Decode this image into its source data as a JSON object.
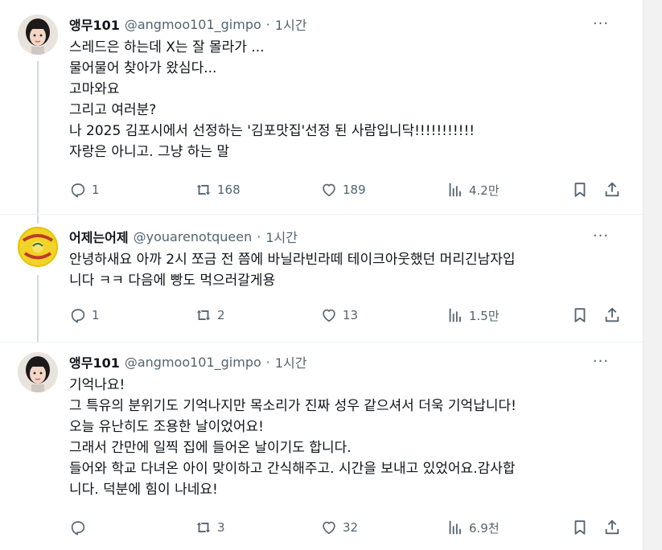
{
  "tweets": [
    {
      "name": "앵무101",
      "handle": "@angmoo101_gimpo",
      "dot": "·",
      "time": "1시간",
      "more": "···",
      "lines": [
        "스레드은 하는데 X는 잘 몰라가 ...",
        "물어물어 찾아가 왔심다...",
        "고마와요",
        "그리고 여러분?",
        "나 2025 김포시에서 선정하는 '김포맛집'선정 된 사람입니닥!!!!!!!!!!!",
        "자랑은 아니고. 그냥 하는 말"
      ],
      "replies": "1",
      "retweets": "168",
      "likes": "189",
      "views": "4.2만"
    },
    {
      "name": "어제는어제",
      "handle": "@youarenotqueen",
      "dot": "·",
      "time": "1시간",
      "more": "···",
      "lines": [
        "안녕하새요 아까 2시 쪼금 전 쯤에 바닐라빈라떼 테이크아웃했던 머리긴남자입",
        "니다 ㅋㅋ 다음에 빵도 먹으러갈게용"
      ],
      "replies": "1",
      "retweets": "2",
      "likes": "13",
      "views": "1.5만"
    },
    {
      "name": "앵무101",
      "handle": "@angmoo101_gimpo",
      "dot": "·",
      "time": "1시간",
      "more": "···",
      "lines": [
        "기억나요!",
        "그 특유의 분위기도 기억나지만 목소리가 진짜 성우 같으셔서 더욱 기억납니다!",
        "오늘 유난히도 조용한 날이었어요!",
        "그래서 간만에 일찍 집에 들어온 날이기도 합니다.",
        "들어와 학교 다녀온 아이 맞이하고 간식해주고. 시간을 보내고 있었어요.감사합",
        "니다. 덕분에 힘이 나네요!"
      ],
      "replies": "",
      "retweets": "3",
      "likes": "32",
      "views": "6.9천"
    }
  ],
  "colors": {
    "text": "#0f1419",
    "secondary": "#536471",
    "thread_line": "#cfd9de",
    "avatar_b_bg": "#f2d327"
  },
  "icons": [
    "reply-icon",
    "retweet-icon",
    "like-icon",
    "views-icon",
    "bookmark-icon",
    "share-icon",
    "more-icon"
  ]
}
